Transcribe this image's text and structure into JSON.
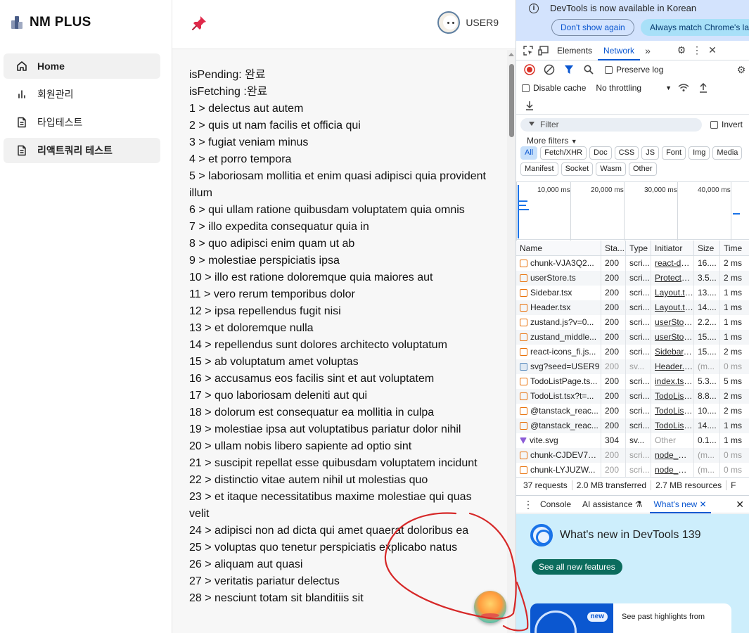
{
  "app": {
    "brand": "NM PLUS",
    "nav": [
      {
        "label": "Home",
        "icon": "home-icon",
        "active": true
      },
      {
        "label": "회원관리",
        "icon": "bar-chart-icon",
        "active": false
      },
      {
        "label": "타입테스트",
        "icon": "document-icon",
        "active": false
      },
      {
        "label": "리액트쿼리 테스트",
        "icon": "document-icon",
        "active": true
      }
    ],
    "user": "USER9",
    "status": {
      "pending": "isPending: 완료",
      "fetching": "isFetching :완료"
    },
    "todos": [
      "1 > delectus aut autem",
      "2 > quis ut nam facilis et officia qui",
      "3 > fugiat veniam minus",
      "4 > et porro tempora",
      "5 > laboriosam mollitia et enim quasi adipisci quia provident illum",
      "6 > qui ullam ratione quibusdam voluptatem quia omnis",
      "7 > illo expedita consequatur quia in",
      "8 > quo adipisci enim quam ut ab",
      "9 > molestiae perspiciatis ipsa",
      "10 > illo est ratione doloremque quia maiores aut",
      "11 > vero rerum temporibus dolor",
      "12 > ipsa repellendus fugit nisi",
      "13 > et doloremque nulla",
      "14 > repellendus sunt dolores architecto voluptatum",
      "15 > ab voluptatum amet voluptas",
      "16 > accusamus eos facilis sint et aut voluptatem",
      "17 > quo laboriosam deleniti aut qui",
      "18 > dolorum est consequatur ea mollitia in culpa",
      "19 > molestiae ipsa aut voluptatibus pariatur dolor nihil",
      "20 > ullam nobis libero sapiente ad optio sint",
      "21 > suscipit repellat esse quibusdam voluptatem incidunt",
      "22 > distinctio vitae autem nihil ut molestias quo",
      "23 > et itaque necessitatibus maxime molestiae qui quas velit",
      "24 > adipisci non ad dicta qui amet quaerat doloribus ea",
      "25 > voluptas quo tenetur perspiciatis explicabo natus",
      "26 > aliquam aut quasi",
      "27 > veritatis pariatur delectus",
      "28 > nesciunt totam sit blanditiis sit"
    ]
  },
  "devtools": {
    "infobar": {
      "message": "DevTools is now available in Korean",
      "dismiss": "Don't show again",
      "match": "Always match Chrome's language"
    },
    "tabs": {
      "elements": "Elements",
      "network": "Network"
    },
    "toolbar": {
      "preserve_log": "Preserve log",
      "disable_cache": "Disable cache",
      "throttling": "No throttling"
    },
    "filter": {
      "placeholder": "Filter",
      "invert": "Invert",
      "more_filters": "More filters"
    },
    "chips": [
      "All",
      "Fetch/XHR",
      "Doc",
      "CSS",
      "JS",
      "Font",
      "Img",
      "Media",
      "Manifest",
      "Socket",
      "Wasm",
      "Other"
    ],
    "timeline_labels": [
      "10,000 ms",
      "20,000 ms",
      "30,000 ms",
      "40,000 ms"
    ],
    "columns": [
      "Name",
      "Sta...",
      "Type",
      "Initiator",
      "Size",
      "Time"
    ],
    "rows": [
      {
        "name": "chunk-VJA3Q2...",
        "status": "200",
        "type": "scri...",
        "initiator": "react-dom...",
        "size": "16....",
        "time": "2 ms",
        "icon": "script",
        "dim": false
      },
      {
        "name": "userStore.ts",
        "status": "200",
        "type": "scri...",
        "initiator": "ProtectedR...",
        "size": "3.5...",
        "time": "2 ms",
        "icon": "script",
        "dim": false
      },
      {
        "name": "Sidebar.tsx",
        "status": "200",
        "type": "scri...",
        "initiator": "Layout.tsx:...",
        "size": "13....",
        "time": "1 ms",
        "icon": "script",
        "dim": false
      },
      {
        "name": "Header.tsx",
        "status": "200",
        "type": "scri...",
        "initiator": "Layout.tsx:...",
        "size": "14....",
        "time": "1 ms",
        "icon": "script",
        "dim": false
      },
      {
        "name": "zustand.js?v=0...",
        "status": "200",
        "type": "scri...",
        "initiator": "userStore.t...",
        "size": "2.2...",
        "time": "1 ms",
        "icon": "script",
        "dim": false
      },
      {
        "name": "zustand_middle...",
        "status": "200",
        "type": "scri...",
        "initiator": "userStore.t...",
        "size": "15....",
        "time": "1 ms",
        "icon": "script",
        "dim": false
      },
      {
        "name": "react-icons_fi.js...",
        "status": "200",
        "type": "scri...",
        "initiator": "Sidebar.tsx...",
        "size": "15....",
        "time": "2 ms",
        "icon": "script",
        "dim": false
      },
      {
        "name": "svg?seed=USER9",
        "status": "200",
        "type": "sv...",
        "initiator": "Header.tsx...",
        "size": "(m...",
        "time": "0 ms",
        "icon": "img",
        "dim": true
      },
      {
        "name": "TodoListPage.ts...",
        "status": "200",
        "type": "scri...",
        "initiator": "index.tsx:1...",
        "size": "5.3...",
        "time": "5 ms",
        "icon": "script",
        "dim": false
      },
      {
        "name": "TodoList.tsx?t=...",
        "status": "200",
        "type": "scri...",
        "initiator": "TodoListPa...",
        "size": "8.8...",
        "time": "2 ms",
        "icon": "script",
        "dim": false
      },
      {
        "name": "@tanstack_reac...",
        "status": "200",
        "type": "scri...",
        "initiator": "TodoListPa...",
        "size": "10....",
        "time": "2 ms",
        "icon": "script",
        "dim": false
      },
      {
        "name": "@tanstack_reac...",
        "status": "200",
        "type": "scri...",
        "initiator": "TodoListPa...",
        "size": "14....",
        "time": "1 ms",
        "icon": "script",
        "dim": false
      },
      {
        "name": "vite.svg",
        "status": "304",
        "type": "sv...",
        "initiator": "Other",
        "size": "0.1...",
        "time": "1 ms",
        "icon": "svg",
        "dim": false
      },
      {
        "name": "chunk-CJDEV7E...",
        "status": "200",
        "type": "scri...",
        "initiator": "node_mod...",
        "size": "(m...",
        "time": "0 ms",
        "icon": "script",
        "dim": true
      },
      {
        "name": "chunk-LYJUZW...",
        "status": "200",
        "type": "scri...",
        "initiator": "node_mod...",
        "size": "(m...",
        "time": "0 ms",
        "icon": "script",
        "dim": true
      }
    ],
    "summary": {
      "requests": "37 requests",
      "transferred": "2.0 MB transferred",
      "resources": "2.7 MB resources",
      "more": "F"
    },
    "drawer": {
      "console": "Console",
      "ai": "AI assistance",
      "whatsnew": "What's new"
    },
    "whatsnew": {
      "title": "What's new in DevTools 139",
      "button": "See all new features",
      "badge": "new",
      "card_text": "See past highlights from"
    }
  },
  "colors": {
    "accent": "#0b57d0",
    "scribble": "#d62828",
    "pin": "#e0294a"
  }
}
